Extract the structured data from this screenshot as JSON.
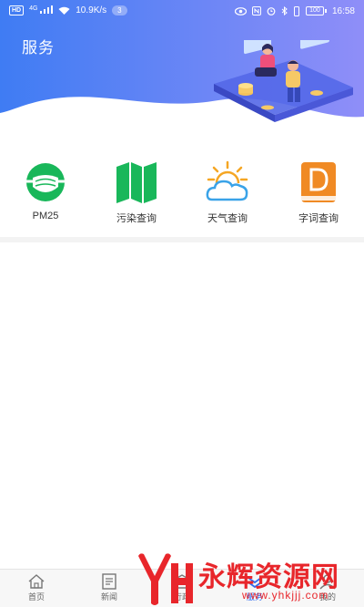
{
  "status_bar": {
    "hd": "HD",
    "signal": "4G",
    "net_speed": "10.9K/s",
    "notification_count": "3",
    "battery": "100",
    "time": "16:58"
  },
  "header": {
    "title": "服务",
    "gradient_start": "#3f7cf3",
    "gradient_end": "#8f8ef8"
  },
  "services": [
    {
      "label": "PM25",
      "icon": "mask-icon",
      "color": "#19b75a"
    },
    {
      "label": "污染查询",
      "icon": "map-icon",
      "color": "#19b75a"
    },
    {
      "label": "天气查询",
      "icon": "weather-icon",
      "color": "#3aa3e8"
    },
    {
      "label": "字词查询",
      "icon": "dictionary-icon",
      "color": "#f08a24"
    }
  ],
  "bottom_nav": [
    {
      "label": "首页",
      "icon": "home-icon"
    },
    {
      "label": "新闻",
      "icon": "news-icon"
    },
    {
      "label": "行政",
      "icon": "admin-icon"
    },
    {
      "label": "服务",
      "icon": "service-icon",
      "active": true
    },
    {
      "label": "我的",
      "icon": "profile-icon"
    }
  ],
  "watermark": {
    "logo_text": "YH",
    "text": "永辉资源网",
    "url": "www.yhkjjj.com",
    "color": "#e8262b"
  }
}
